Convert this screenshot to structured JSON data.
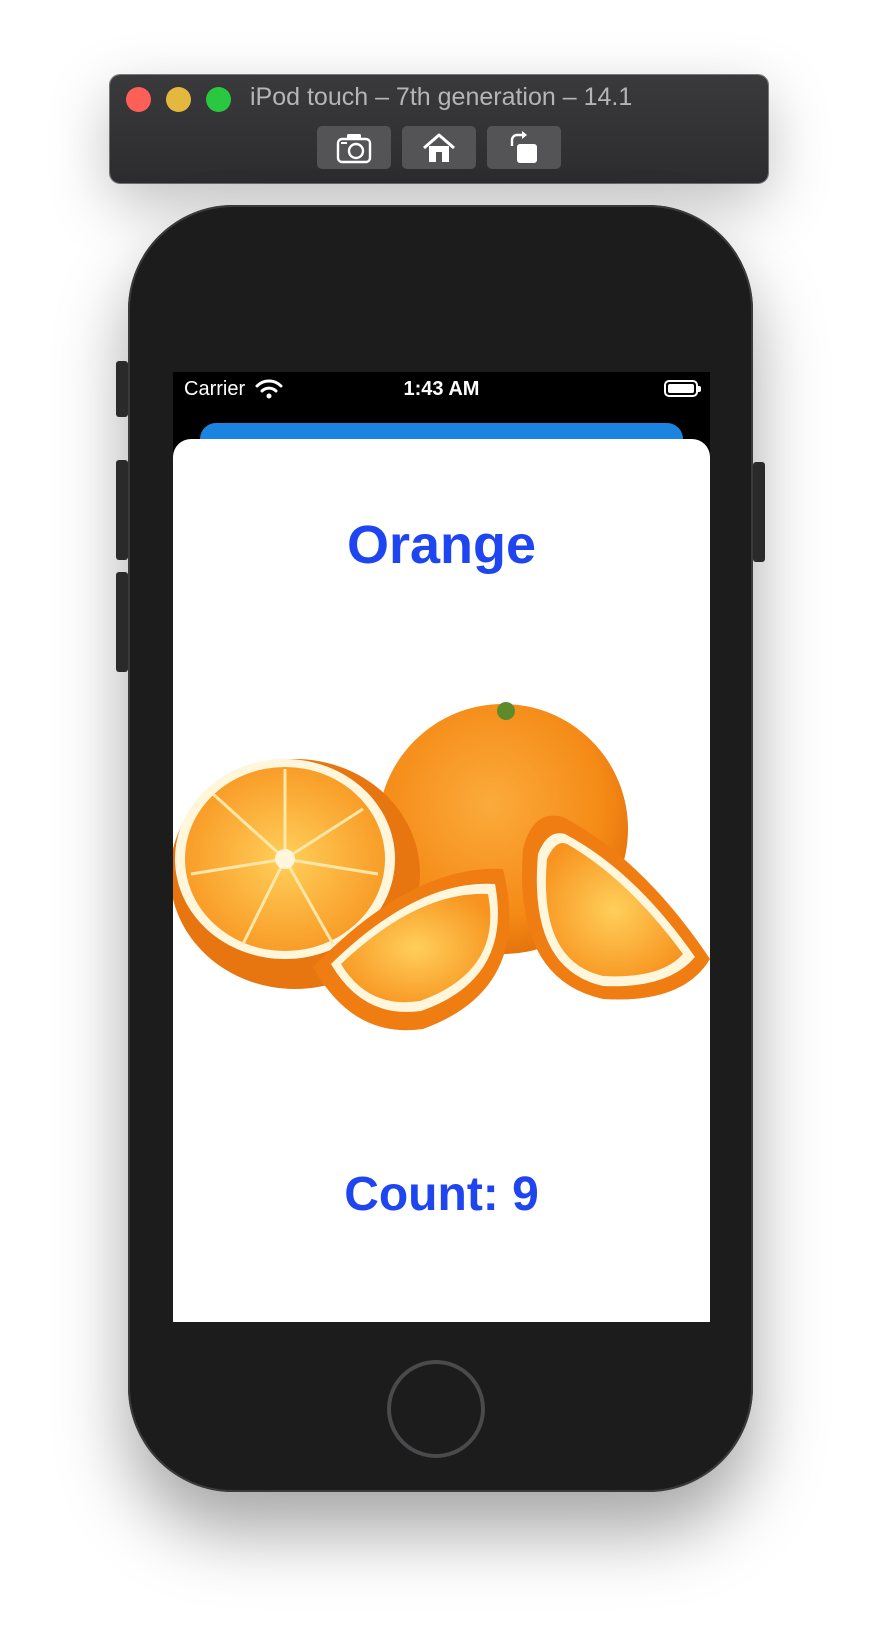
{
  "simulator": {
    "title": "iPod touch – 7th generation – 14.1",
    "buttons": [
      {
        "icon": "camera-icon"
      },
      {
        "icon": "home-icon"
      },
      {
        "icon": "rotate-icon"
      }
    ]
  },
  "status_bar": {
    "carrier": "Carrier",
    "time": "1:43 AM"
  },
  "content": {
    "title": "Orange",
    "image_subject": "oranges",
    "count_label": "Count: 9"
  },
  "colors": {
    "title_blue": "#1e45f0",
    "sheet_behind_blue": "#1a84e0",
    "orange": "#f7941d"
  }
}
